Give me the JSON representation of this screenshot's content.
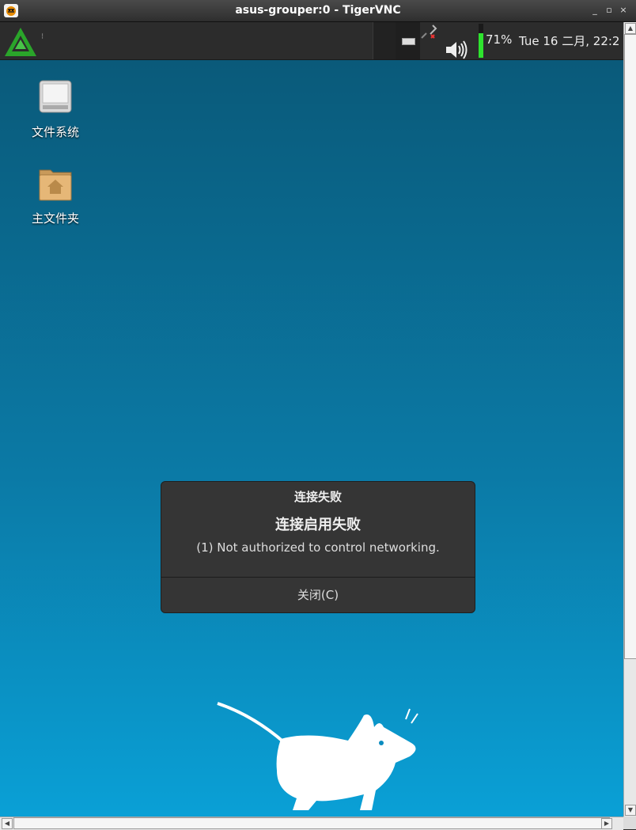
{
  "window": {
    "title": "asus-grouper:0 - TigerVNC",
    "icons": [
      "tigervnc-icon",
      "minimize-icon",
      "maximize-icon",
      "close-icon"
    ],
    "controls": {
      "minimize": "_",
      "maximize": "▫",
      "close": "×"
    }
  },
  "panel": {
    "handle": "⁝",
    "battery_percent": "71%",
    "battery_level": 0.71,
    "battery_color": "#2ee32e",
    "clock": "Tue 16 二月, 22:2",
    "icons": [
      "app-menu-icon",
      "window-icon",
      "network-disconnected-icon",
      "volume-icon"
    ]
  },
  "desktop": {
    "icons": [
      {
        "label": "文件系统",
        "icon": "drive-icon"
      },
      {
        "label": "主文件夹",
        "icon": "home-folder-icon"
      }
    ],
    "wallpaper": "xfce-mouse",
    "accent": "#0aa0d6"
  },
  "dialog": {
    "title": "连接失败",
    "heading": "连接启用失败",
    "message": "(1) Not authorized to control networking.",
    "button": "关闭(C)"
  }
}
